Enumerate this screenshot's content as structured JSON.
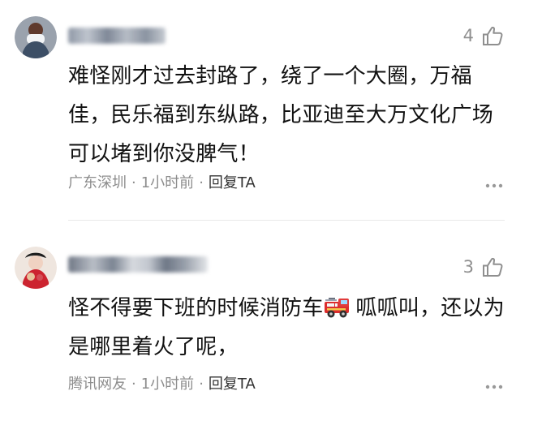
{
  "comments": [
    {
      "likes": "4",
      "text": "难怪刚才过去封路了，绕了一个大圈，万福佳，民乐福到东纵路，比亚迪至大万文化广场可以堵到你没脾气！",
      "location": "广东深圳",
      "time": "1小时前",
      "reply_label": "回复TA",
      "separator": "·"
    },
    {
      "likes": "3",
      "text_before": "怪不得要下班的时候消防车",
      "text_after": "呱呱叫，还以为是哪里着火了呢，",
      "source": "腾讯网友",
      "time": "1小时前",
      "reply_label": "回复TA",
      "separator": "·"
    }
  ],
  "icons": {
    "like": "thumbs-up-icon",
    "more": "more-icon",
    "emoji": "fire-engine-icon"
  }
}
